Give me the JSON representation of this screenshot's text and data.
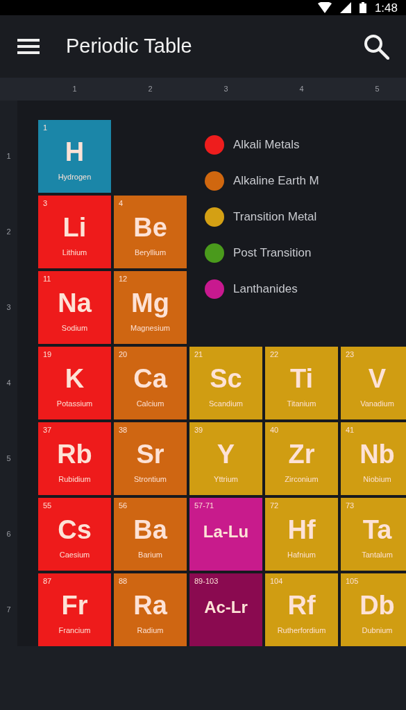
{
  "status_bar": {
    "time": "1:48"
  },
  "app_bar": {
    "title": "Periodic Table"
  },
  "column_headers": [
    "1",
    "2",
    "3",
    "4",
    "5"
  ],
  "legend": [
    {
      "label": "Alkali Metals",
      "color": "#ee1d1d"
    },
    {
      "label": "Alkaline Earth M",
      "color": "#d0670f"
    },
    {
      "label": "Transition Metal",
      "color": "#d4a014"
    },
    {
      "label": "Post Transition",
      "color": "#4a9a1c"
    },
    {
      "label": "Lanthanides",
      "color": "#c8198f"
    }
  ],
  "periods": [
    {
      "label": "1",
      "cells": [
        {
          "number": "1",
          "symbol": "H",
          "name": "Hydrogen",
          "color": "#1b86a8"
        }
      ]
    },
    {
      "label": "2",
      "cells": [
        {
          "number": "3",
          "symbol": "Li",
          "name": "Lithium",
          "color": "#ee1b1b"
        },
        {
          "number": "4",
          "symbol": "Be",
          "name": "Beryllium",
          "color": "#cf6612"
        }
      ]
    },
    {
      "label": "3",
      "cells": [
        {
          "number": "11",
          "symbol": "Na",
          "name": "Sodium",
          "color": "#ee1b1b"
        },
        {
          "number": "12",
          "symbol": "Mg",
          "name": "Magnesium",
          "color": "#cf6612"
        }
      ]
    },
    {
      "label": "4",
      "cells": [
        {
          "number": "19",
          "symbol": "K",
          "name": "Potassium",
          "color": "#ee1b1b"
        },
        {
          "number": "20",
          "symbol": "Ca",
          "name": "Calcium",
          "color": "#cf6612"
        },
        {
          "number": "21",
          "symbol": "Sc",
          "name": "Scandium",
          "color": "#d09d12"
        },
        {
          "number": "22",
          "symbol": "Ti",
          "name": "Titanium",
          "color": "#d09d12"
        },
        {
          "number": "23",
          "symbol": "V",
          "name": "Vanadium",
          "color": "#d09d12"
        }
      ]
    },
    {
      "label": "5",
      "cells": [
        {
          "number": "37",
          "symbol": "Rb",
          "name": "Rubidium",
          "color": "#ee1b1b"
        },
        {
          "number": "38",
          "symbol": "Sr",
          "name": "Strontium",
          "color": "#cf6612"
        },
        {
          "number": "39",
          "symbol": "Y",
          "name": "Yttrium",
          "color": "#d09d12"
        },
        {
          "number": "40",
          "symbol": "Zr",
          "name": "Zirconium",
          "color": "#d09d12"
        },
        {
          "number": "41",
          "symbol": "Nb",
          "name": "Niobium",
          "color": "#d09d12"
        }
      ]
    },
    {
      "label": "6",
      "cells": [
        {
          "number": "55",
          "symbol": "Cs",
          "name": "Caesium",
          "color": "#ee1b1b"
        },
        {
          "number": "56",
          "symbol": "Ba",
          "name": "Barium",
          "color": "#cf6612"
        },
        {
          "number": "57-71",
          "symbol": "La-Lu",
          "color": "#c81b8c"
        },
        {
          "number": "72",
          "symbol": "Hf",
          "name": "Hafnium",
          "color": "#d09d12"
        },
        {
          "number": "73",
          "symbol": "Ta",
          "name": "Tantalum",
          "color": "#d09d12"
        }
      ]
    },
    {
      "label": "7",
      "cells": [
        {
          "number": "87",
          "symbol": "Fr",
          "name": "Francium",
          "color": "#ee1b1b"
        },
        {
          "number": "88",
          "symbol": "Ra",
          "name": "Radium",
          "color": "#cf6612"
        },
        {
          "number": "89-103",
          "symbol": "Ac-Lr",
          "color": "#8a0a50"
        },
        {
          "number": "104",
          "symbol": "Rf",
          "name": "Rutherfordium",
          "color": "#d09d12"
        },
        {
          "number": "105",
          "symbol": "Db",
          "name": "Dubnium",
          "color": "#d09d12"
        }
      ]
    }
  ]
}
